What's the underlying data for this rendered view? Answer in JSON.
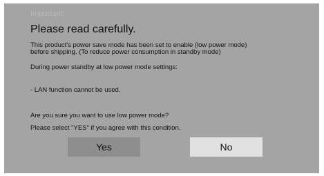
{
  "dialog": {
    "heading": "Important:",
    "title": "Please read carefully.",
    "body": {
      "line1": "This product's power save mode has been set to enable (low power mode)",
      "line2": "before shipping. (To reduce power consumption in standby mode)",
      "line3": "During power standby at low power mode settings:",
      "line4": "- LAN function cannot be used.",
      "line5": "Are you sure you want to use low power mode?",
      "line6": "Please select \"YES\" if you agree with this condition."
    },
    "buttons": {
      "yes_label": "Yes",
      "no_label": "No"
    }
  },
  "colors": {
    "dialog_background": "#a4a4a4",
    "yes_button_selected": "#8e8e8e",
    "no_button": "#e1e1e1",
    "heading_text": "#b9b9b9"
  }
}
